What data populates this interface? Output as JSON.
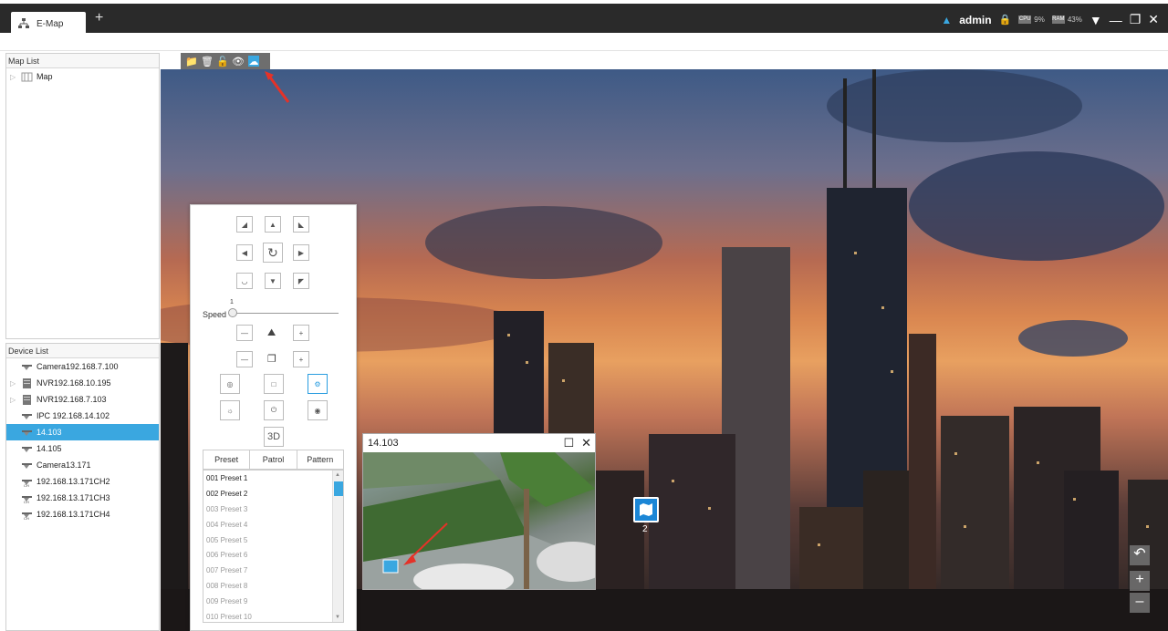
{
  "topbar": {
    "tab_label": "E-Map",
    "add_tab": "+",
    "username": "admin",
    "cpu_chip": "CPU",
    "cpu_value": "9%",
    "ram_chip": "RAM",
    "ram_value": "43%"
  },
  "map_list": {
    "title": "Map List",
    "items": [
      {
        "label": "Map"
      }
    ]
  },
  "device_list": {
    "title": "Device List",
    "items": [
      {
        "label": "Camera192.168.7.100",
        "icon": "camera-icon"
      },
      {
        "label": "NVR192.168.10.195",
        "icon": "nvr-icon"
      },
      {
        "label": "NVR192.168.7.103",
        "icon": "nvr-icon"
      },
      {
        "label": "IPC 192.168.14.102",
        "icon": "camera-icon"
      },
      {
        "label": "14.103",
        "icon": "camera-icon",
        "selected": true
      },
      {
        "label": "14.105",
        "icon": "camera-icon"
      },
      {
        "label": "Camera13.171",
        "icon": "camera-icon"
      },
      {
        "label": "192.168.13.171CH2",
        "icon": "channel-icon"
      },
      {
        "label": "192.168.13.171CH3",
        "icon": "channel-icon"
      },
      {
        "label": "192.168.13.171CH4",
        "icon": "channel-icon"
      }
    ]
  },
  "ptz": {
    "speed_label": "Speed",
    "speed_value": "1",
    "three_d_label": "3D",
    "tabs": [
      "Preset",
      "Patrol",
      "Pattern"
    ],
    "presets": [
      "001 Preset 1",
      "002 Preset 2",
      "003 Preset 3",
      "004 Preset 4",
      "005 Preset 5",
      "006 Preset 6",
      "007 Preset 7",
      "008 Preset 8",
      "009 Preset 9",
      "010 Preset 10"
    ]
  },
  "video_popup": {
    "title": "14.103"
  },
  "map_pin": {
    "label": "2"
  },
  "colors": {
    "accent": "#3aa7e0",
    "topbar": "#2a2a2a"
  }
}
